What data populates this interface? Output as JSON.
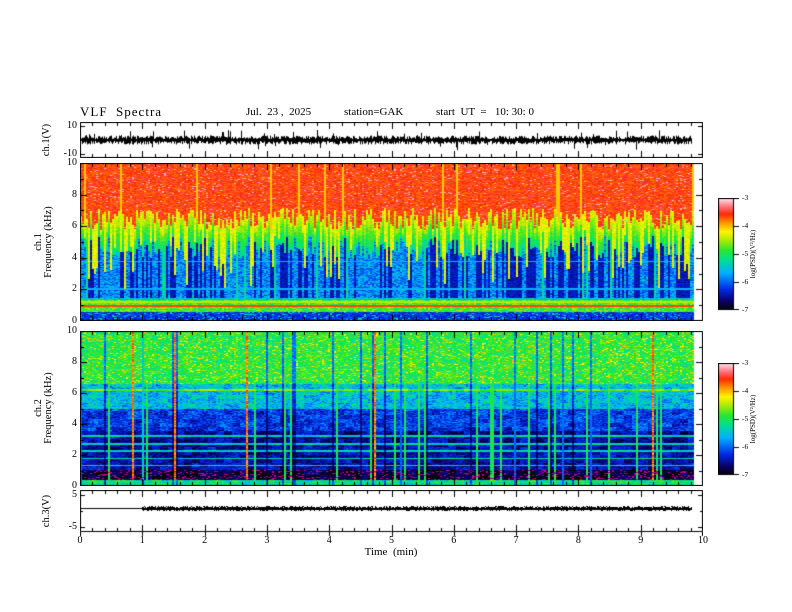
{
  "header": {
    "title": "VLF  Spectra",
    "date": "Jul.  23 ,  2025",
    "station": "station=GAK",
    "start_ut": "start  UT  =   10: 30: 0"
  },
  "xaxis": {
    "label": "Time  (min)",
    "tick_labels": [
      "0",
      "1",
      "2",
      "3",
      "4",
      "5",
      "6",
      "7",
      "8",
      "9",
      "10"
    ],
    "tick_values": [
      0,
      1,
      2,
      3,
      4,
      5,
      6,
      7,
      8,
      9,
      10
    ]
  },
  "panels": {
    "ch1_wave": {
      "ylabel": "ch.1(V)",
      "ytick_labels": [
        "10",
        "-10"
      ],
      "ytick_values": [
        10,
        -10
      ]
    },
    "ch1_spec": {
      "ylabel_lines": [
        "ch.1",
        "Frequency  (kHz)"
      ],
      "ytick_labels": [
        "0",
        "2",
        "4",
        "6",
        "8",
        "10"
      ],
      "ytick_values": [
        0,
        2,
        4,
        6,
        8,
        10
      ]
    },
    "ch2_spec": {
      "ylabel_lines": [
        "ch.2",
        "Frequency  (kHz)"
      ],
      "ytick_labels": [
        "0",
        "2",
        "4",
        "6",
        "8",
        "10"
      ],
      "ytick_values": [
        0,
        2,
        4,
        6,
        8,
        10
      ]
    },
    "ch3_wave": {
      "ylabel": "ch.3(V)",
      "ytick_labels": [
        "5",
        "-5"
      ],
      "ytick_values": [
        5,
        -5
      ]
    }
  },
  "colorbars": [
    {
      "label": "log(PSD)(V²/Hz)",
      "tick_labels": [
        "-3",
        "-4",
        "-5",
        "-6",
        "-7"
      ],
      "tick_values": [
        -3,
        -4,
        -5,
        -6,
        -7
      ]
    },
    {
      "label": "log(PSD)(V²/Hz)",
      "tick_labels": [
        "-3",
        "-4",
        "-5",
        "-6",
        "-7"
      ],
      "tick_values": [
        -3,
        -4,
        -5,
        -6,
        -7
      ]
    }
  ],
  "chart_data": [
    {
      "type": "line",
      "title": "ch.1 raw waveform",
      "xlabel": "Time (min)",
      "ylabel": "ch.1(V)",
      "xlim": [
        0,
        10
      ],
      "yticks": [
        10,
        -10
      ],
      "data_extent_min": [
        0,
        9.9
      ],
      "description": "Dense black noise band centred on 0 V, typical excursions ±1–3 V, frequent impulsive spikes to about ±8 V over the whole record."
    },
    {
      "type": "heatmap",
      "title": "ch.1 spectrogram",
      "xlabel": "Time (min)",
      "ylabel": "Frequency (kHz)",
      "xlim": [
        0,
        10
      ],
      "ylim": [
        0,
        10
      ],
      "data_extent_min": [
        0,
        9.85
      ],
      "colorbar": {
        "label": "log(PSD)(V²/Hz)",
        "ticks": [
          -3,
          -4,
          -5,
          -6,
          -7
        ],
        "range": [
          -7,
          -3
        ]
      },
      "bands": [
        {
          "freq_khz": [
            6.3,
            10
          ],
          "approx_log_psd": -3.7,
          "appearance": "intense red with pink speckle; yellow vertical streaks descending"
        },
        {
          "freq_khz": [
            4.6,
            6.3
          ],
          "approx_log_psd": -4.8,
          "appearance": "jagged yellow-green-cyan transition with strong columnar texture"
        },
        {
          "freq_khz": [
            1.5,
            4.6
          ],
          "approx_log_psd": -6.0,
          "appearance": "blue with dense dark-navy vertical stripes, occasional cyan columns, faint cyan horizontal lines near 3.8 and 2.0 kHz"
        },
        {
          "freq_khz": [
            0.6,
            1.4
          ],
          "approx_log_psd": -4.8,
          "appearance": "green/yellow horizontal band with thin red line near 0.95 kHz"
        },
        {
          "freq_khz": [
            0,
            0.6
          ],
          "approx_log_psd": -6.5,
          "appearance": "dark navy/black with cyan speckle"
        }
      ]
    },
    {
      "type": "heatmap",
      "title": "ch.2 spectrogram",
      "xlabel": "Time (min)",
      "ylabel": "Frequency (kHz)",
      "xlim": [
        0,
        10
      ],
      "ylim": [
        0,
        10
      ],
      "data_extent_min": [
        0,
        9.85
      ],
      "colorbar": {
        "label": "log(PSD)(V²/Hz)",
        "ticks": [
          -3,
          -4,
          -5,
          -6,
          -7
        ],
        "range": [
          -7,
          -3
        ]
      },
      "bands": [
        {
          "freq_khz": [
            6.6,
            10
          ],
          "approx_log_psd": -4.6,
          "appearance": "bright green with yellow speckle and scattered full-height red/orange streaks"
        },
        {
          "freq_khz": [
            5.0,
            6.6
          ],
          "approx_log_psd": -5.4,
          "appearance": "cyan/green blocky mix; thin yellow-green horizontal line near 6.2 kHz"
        },
        {
          "freq_khz": [
            3.6,
            5.0
          ],
          "approx_log_psd": -6.0,
          "appearance": "blue blocky with dark patches"
        },
        {
          "freq_khz": [
            1.0,
            3.6
          ],
          "approx_log_psd": -6.7,
          "appearance": "navy/black blocks crossed by thin cyan horizontal lines and vertical green streaks"
        },
        {
          "freq_khz": [
            0.45,
            1.0
          ],
          "approx_log_psd": -7.0,
          "appearance": "black band with magenta speckle"
        },
        {
          "freq_khz": [
            0,
            0.45
          ],
          "approx_log_psd": -5.5,
          "appearance": "cyan/green line along the bottom edge"
        }
      ]
    },
    {
      "type": "line",
      "title": "ch.3 level",
      "xlabel": "Time (min)",
      "ylabel": "ch.3(V)",
      "xlim": [
        0,
        10
      ],
      "yticks": [
        5,
        -5
      ],
      "data_extent_min": [
        0,
        9.8
      ],
      "description": "Nearly constant level of about +0.5 V: thin clean trace from 0 to 1 min, then a thicker dark noisy/dashed trace from 1 min to about 9.8 min."
    }
  ]
}
